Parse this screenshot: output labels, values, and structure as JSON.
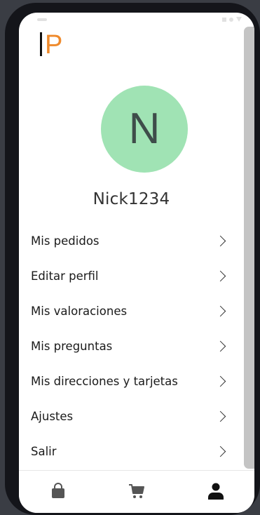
{
  "app": {
    "logo_letter": "P"
  },
  "profile": {
    "avatar_initial": "N",
    "username": "Nick1234"
  },
  "menu": {
    "items": [
      {
        "label": "Mis pedidos"
      },
      {
        "label": "Editar perfil"
      },
      {
        "label": "Mis valoraciones"
      },
      {
        "label": "Mis preguntas"
      },
      {
        "label": "Mis direcciones y tarjetas"
      },
      {
        "label": "Ajustes"
      },
      {
        "label": "Salir"
      }
    ]
  },
  "bottom_nav": {
    "items": [
      {
        "icon": "shopping-bag-icon",
        "active": false
      },
      {
        "icon": "shopping-cart-icon",
        "active": false
      },
      {
        "icon": "user-icon",
        "active": true
      }
    ]
  },
  "colors": {
    "accent": "#ef8a2c",
    "avatar_bg": "#a0e3b4",
    "inactive_icon": "#555555",
    "active_icon": "#111111"
  }
}
